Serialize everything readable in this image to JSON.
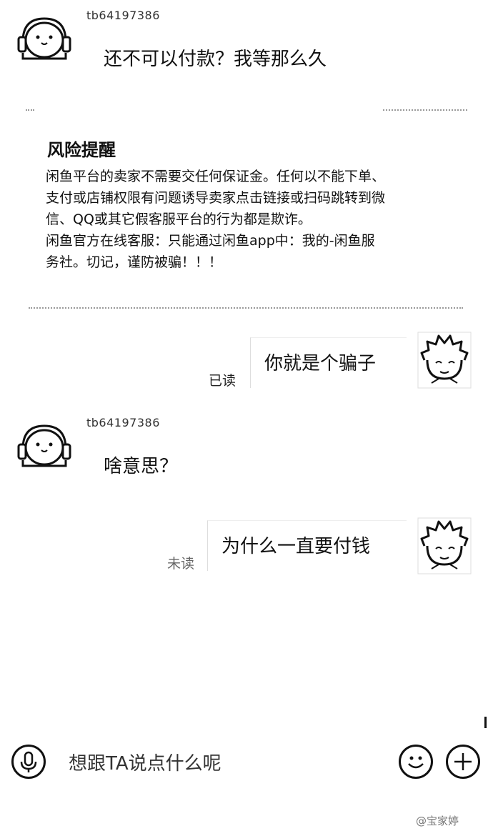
{
  "messages": [
    {
      "username": "tb64197386",
      "text": "还不可以付款？我等那么久"
    },
    {
      "text": "你就是个骗子",
      "status": "已读"
    },
    {
      "username": "tb64197386",
      "text": "啥意思？"
    },
    {
      "text": "为什么一直要付钱",
      "status": "未读"
    }
  ],
  "notice": {
    "title": "风险提醒",
    "lines": [
      "闲鱼平台的卖家不需要交任何保证金。任何以不能下单、",
      "支付或店铺权限有问题诱导卖家点击链接或扫码跳转到微",
      "信、QQ或其它假客服平台的行为都是欺诈。",
      "闲鱼官方在线客服：只能通过闲鱼app中：我的-闲鱼服",
      "务社。切记，谨防被骗！！！"
    ]
  },
  "input": {
    "placeholder": "想跟TA说点什么呢"
  },
  "watermark": "@宝家婷",
  "icons": {
    "voice": "microphone-icon",
    "emoji": "smiley-icon",
    "more": "plus-icon",
    "seller_avatar": "seal-headphones-avatar-icon",
    "buyer_avatar": "spiky-hair-cartoon-avatar-icon"
  }
}
